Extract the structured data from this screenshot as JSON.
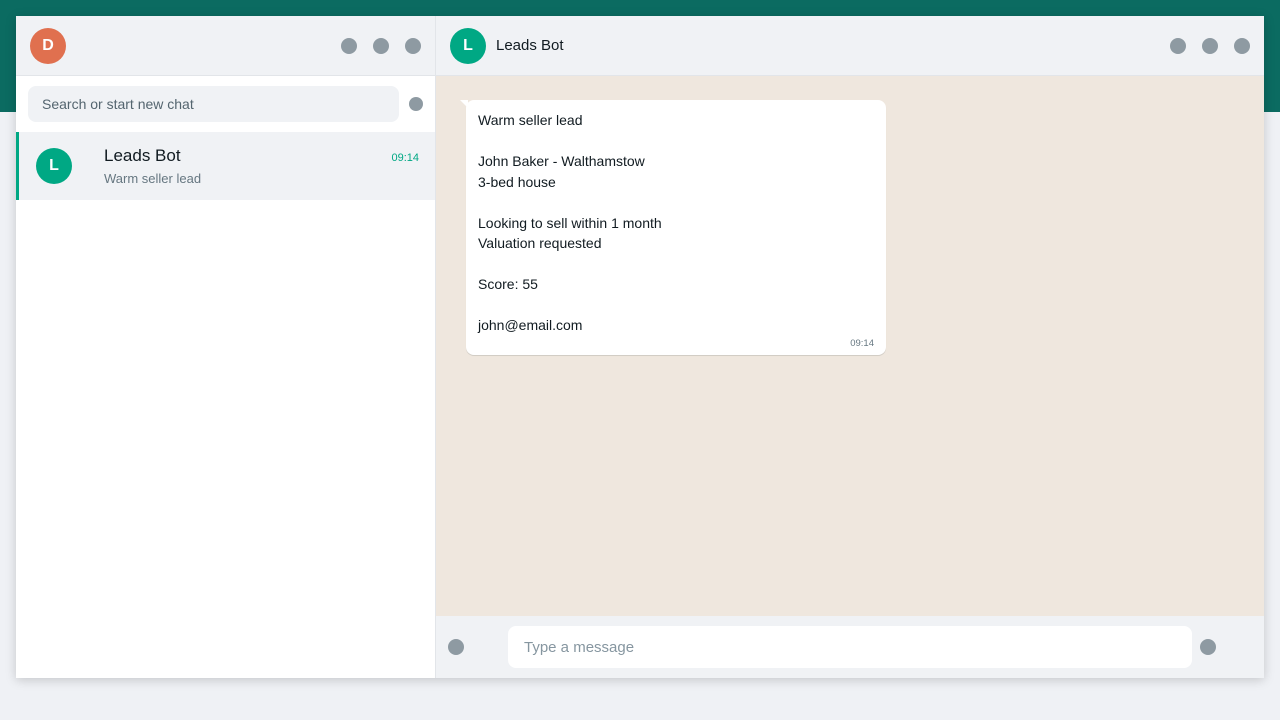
{
  "colors": {
    "brand_band": "#0b6b61",
    "accent": "#00a884",
    "my_avatar": "#e0704f",
    "chat_background": "#efe7de"
  },
  "sidebar": {
    "user_avatar_initial": "D",
    "header_icons": [
      "status-icon",
      "new-chat-icon",
      "menu-icon"
    ],
    "search": {
      "placeholder": "Search or start new chat",
      "value": ""
    },
    "chats": [
      {
        "initial": "L",
        "name": "Leads Bot",
        "time": "09:14",
        "preview": "Warm seller lead",
        "selected": true
      }
    ]
  },
  "conversation": {
    "initial": "L",
    "name": "Leads Bot",
    "header_icons": [
      "video-call-icon",
      "search-icon",
      "menu-icon"
    ],
    "messages": [
      {
        "lines": [
          "Warm seller lead",
          "",
          "John Baker - Walthamstow",
          "3-bed house",
          "",
          "Looking to sell within 1 month",
          "Valuation requested",
          "",
          "Score: 55",
          "",
          "john@email.com"
        ],
        "time": "09:14"
      }
    ],
    "composer": {
      "placeholder": "Type a message",
      "value": ""
    }
  }
}
